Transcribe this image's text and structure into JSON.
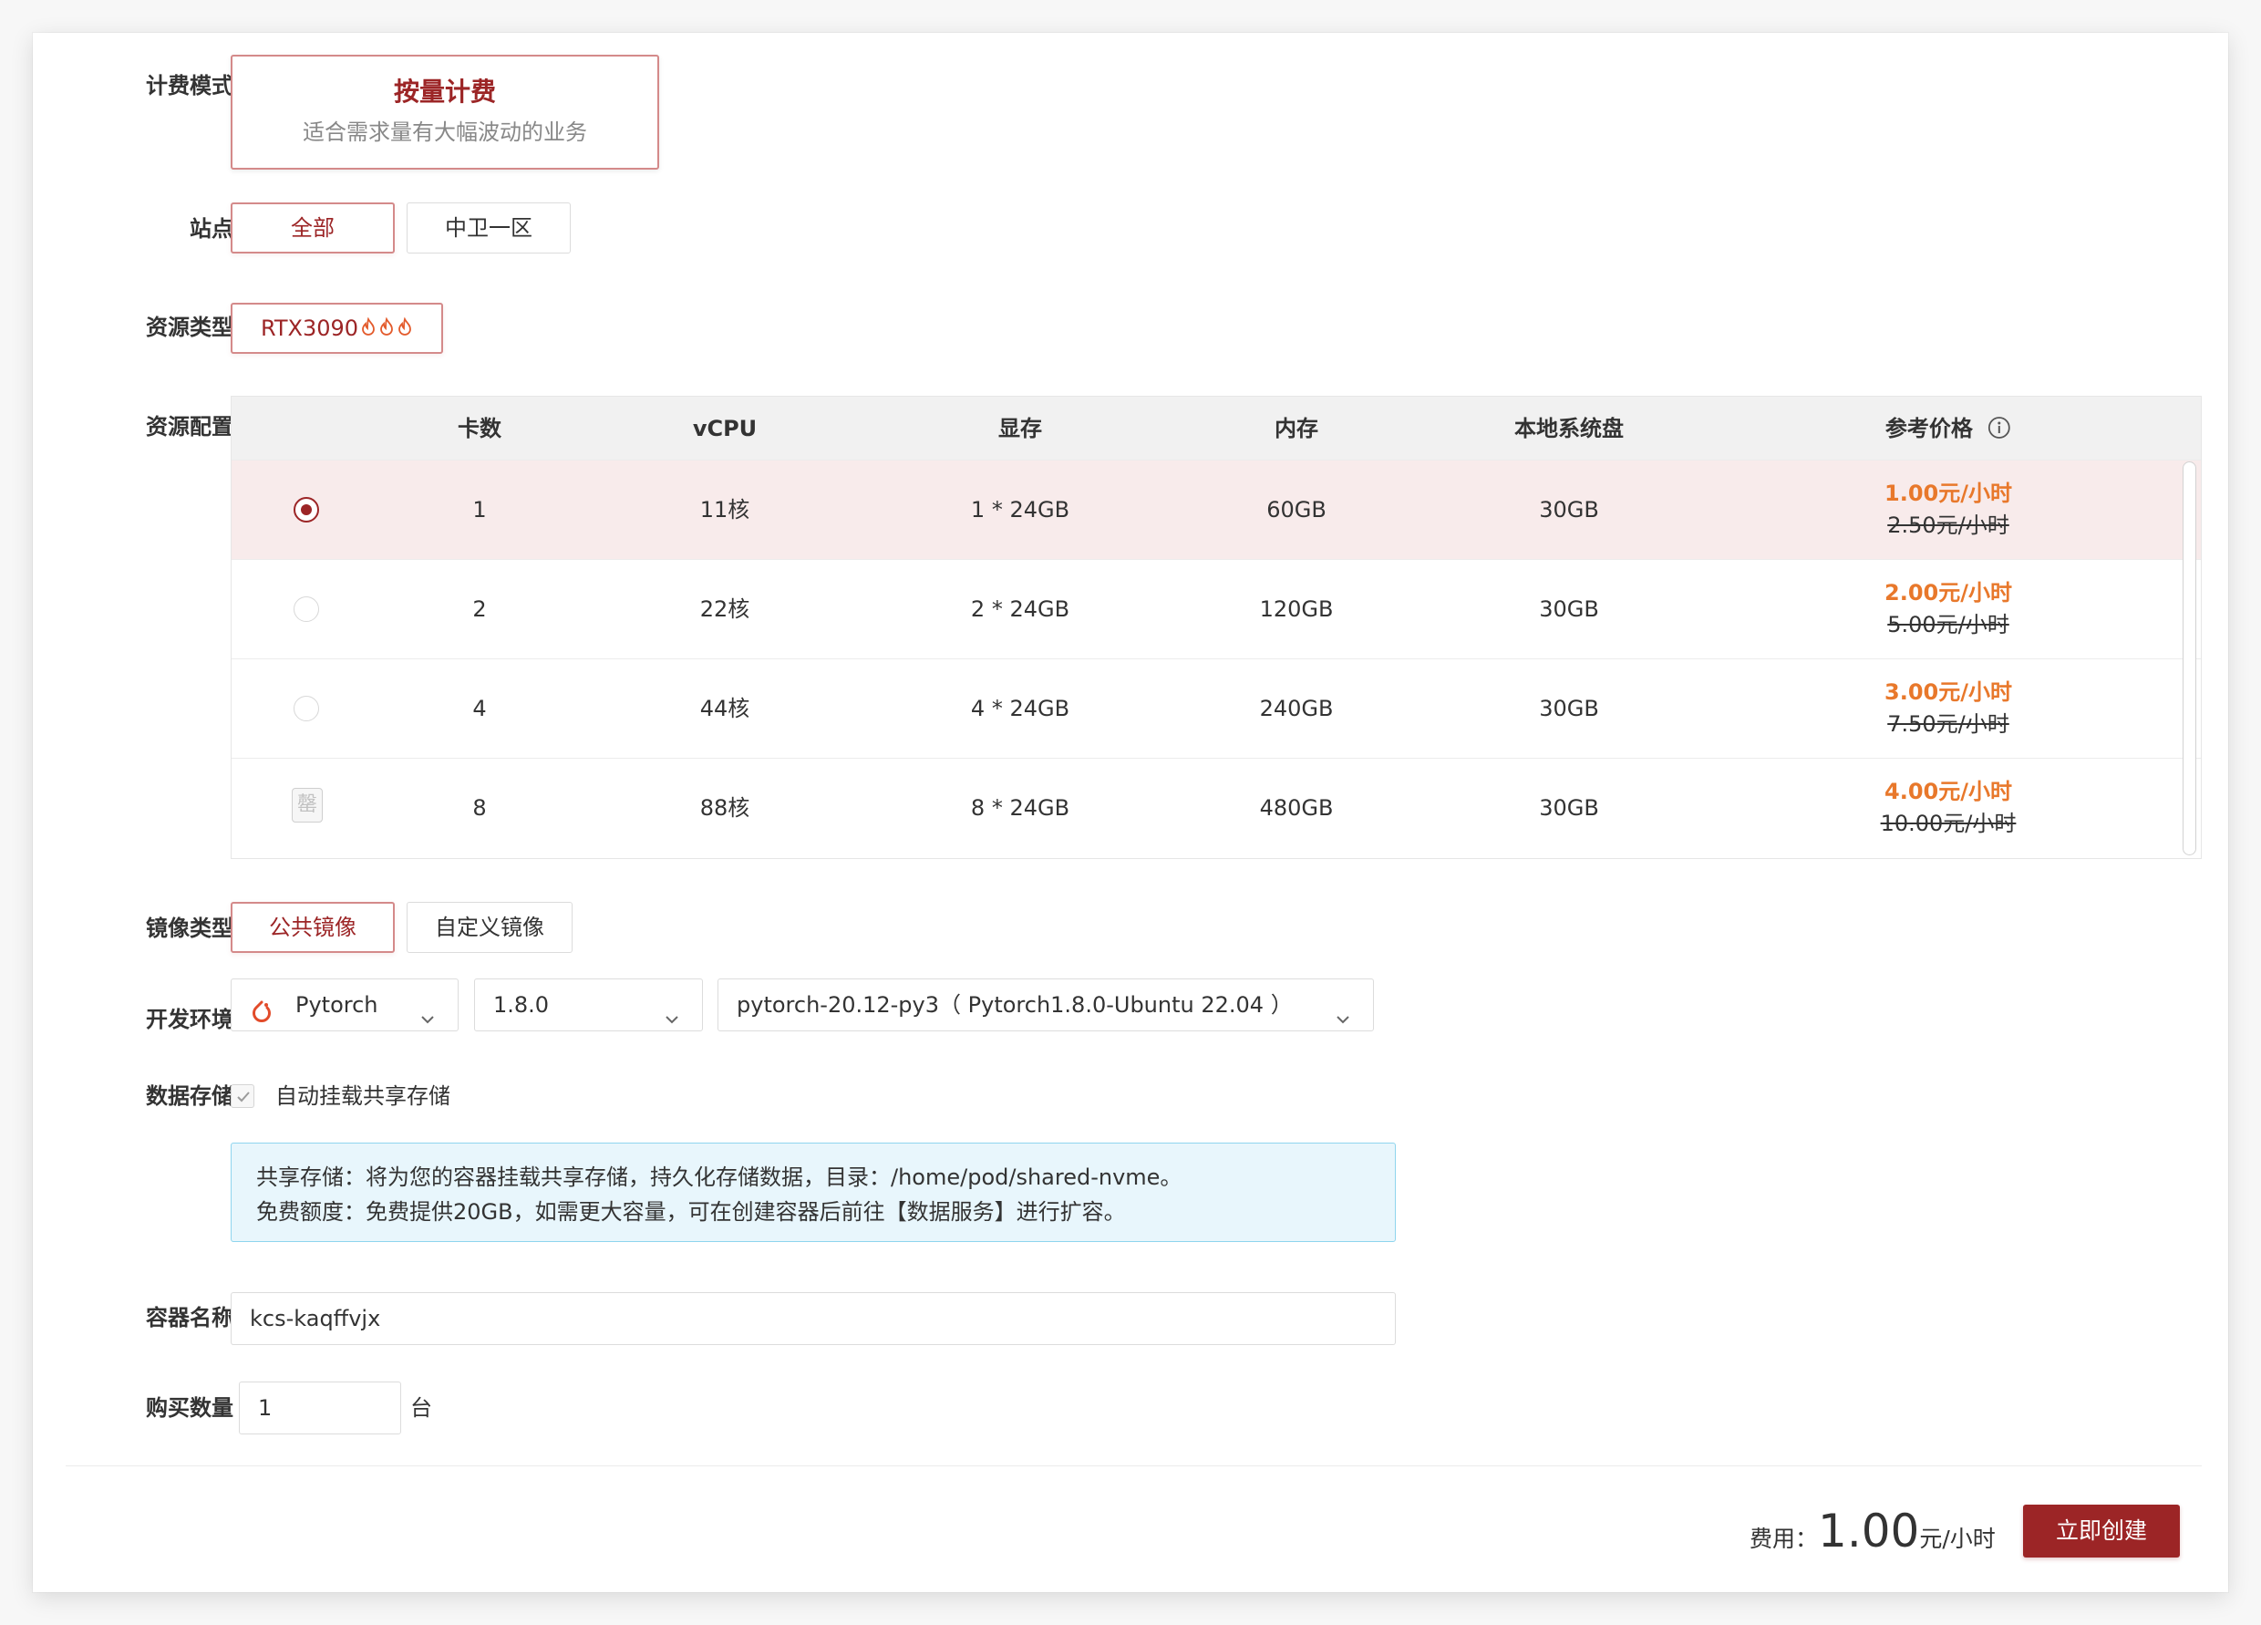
{
  "form": {
    "labels": {
      "billing": "计费模式",
      "site": "站点",
      "resource_type": "资源类型",
      "resource_config": "资源配置",
      "image_type": "镜像类型",
      "dev_env": "开发环境",
      "storage": "数据存储",
      "container_name": "容器名称",
      "quantity": "购买数量"
    },
    "billing": {
      "title": "按量计费",
      "desc": "适合需求量有大幅波动的业务"
    },
    "sites": [
      {
        "label": "全部",
        "selected": true
      },
      {
        "label": "中卫一区",
        "selected": false
      }
    ],
    "resource_types": [
      {
        "label": "RTX3090",
        "selected": true,
        "badge_icon": "flame-icon",
        "badge_count": 3
      }
    ],
    "resource_table": {
      "headers": [
        "卡数",
        "vCPU",
        "显存",
        "内存",
        "本地系统盘",
        "参考价格"
      ],
      "info_icon": "info-icon",
      "rows": [
        {
          "status": "selected",
          "cards": "1",
          "vcpu": "11核",
          "vram": "1 * 24GB",
          "memory": "60GB",
          "disk": "30GB",
          "price": "1.00元/小时",
          "old_price": "2.50元/小时"
        },
        {
          "status": "available",
          "cards": "2",
          "vcpu": "22核",
          "vram": "2 * 24GB",
          "memory": "120GB",
          "disk": "30GB",
          "price": "2.00元/小时",
          "old_price": "5.00元/小时"
        },
        {
          "status": "available",
          "cards": "4",
          "vcpu": "44核",
          "vram": "4 * 24GB",
          "memory": "240GB",
          "disk": "30GB",
          "price": "3.00元/小时",
          "old_price": "7.50元/小时"
        },
        {
          "status": "sold-out",
          "soldout_label": "罄",
          "cards": "8",
          "vcpu": "88核",
          "vram": "8 * 24GB",
          "memory": "480GB",
          "disk": "30GB",
          "price": "4.00元/小时",
          "old_price": "10.00元/小时"
        }
      ]
    },
    "image_types": [
      {
        "label": "公共镜像",
        "selected": true
      },
      {
        "label": "自定义镜像",
        "selected": false
      }
    ],
    "dev_env": {
      "framework_icon": "pytorch-icon",
      "framework": "Pytorch",
      "version": "1.8.0",
      "image": "pytorch-20.12-py3（ Pytorch1.8.0-Ubuntu 22.04 ）"
    },
    "storage": {
      "checked": true,
      "checkbox_label": "自动挂载共享存储",
      "notice_line1": "共享存储：将为您的容器挂载共享存储，持久化存储数据，目录：/home/pod/shared-nvme。",
      "notice_line2": "免费额度：免费提供20GB，如需更大容量，可在创建容器后前往【数据服务】进行扩容。"
    },
    "container_name": {
      "value": "kcs-kaqffvjx"
    },
    "quantity": {
      "value": "1",
      "unit": "台"
    }
  },
  "footer": {
    "fee_label": "费用：",
    "amount": "1.00",
    "unit": "元/小时",
    "submit_label": "立即创建"
  },
  "colors": {
    "brand_red": "#9c2526",
    "selected_border": "#d48a8a",
    "price_orange": "#e8782b",
    "notice_background": "#e8f6fc",
    "notice_border": "#8fd5ee"
  }
}
